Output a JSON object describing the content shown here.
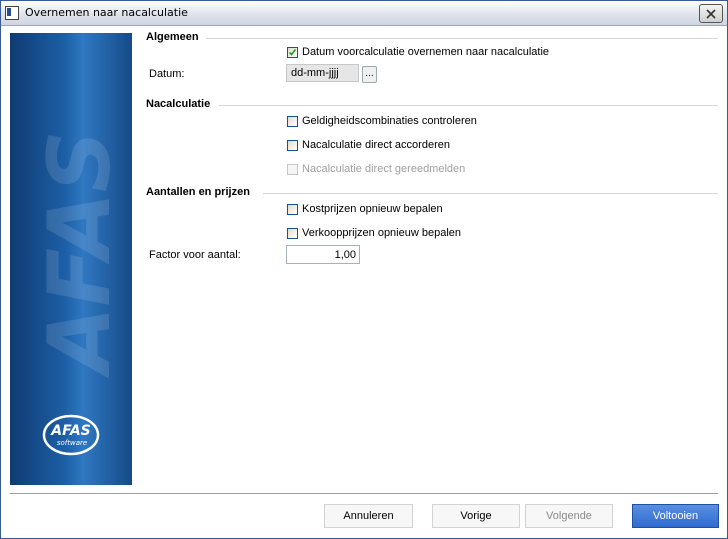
{
  "window": {
    "title": "Overnemen naar nacalculatie"
  },
  "sidebar": {
    "logo_text": "AFAS",
    "logo_subtext": "software"
  },
  "sections": {
    "algemeen": {
      "title": "Algemeen",
      "copy_date_checkbox": {
        "label": "Datum voorcalculatie overnemen naar nacalculatie",
        "checked": true
      },
      "date_label": "Datum:",
      "date_value": "dd-mm-jjjj",
      "date_button": "..."
    },
    "nacalculatie": {
      "title": "Nacalculatie",
      "check_validity": {
        "label": "Geldigheidscombinaties controleren",
        "checked": false
      },
      "approve_direct": {
        "label": "Nacalculatie direct accorderen",
        "checked": false
      },
      "report_ready": {
        "label": "Nacalculatie direct gereedmelden",
        "checked": false,
        "disabled": true
      }
    },
    "aantallen": {
      "title": "Aantallen en prijzen",
      "cost_prices": {
        "label": "Kostprijzen opnieuw bepalen",
        "checked": false
      },
      "sales_prices": {
        "label": "Verkoopprijzen opnieuw bepalen",
        "checked": false
      },
      "factor_label": "Factor voor aantal:",
      "factor_value": "1,00"
    }
  },
  "buttons": {
    "cancel": "Annuleren",
    "previous": "Vorige",
    "next": "Volgende",
    "finish": "Voltooien"
  },
  "colors": {
    "banner": "#1d5fa6",
    "primary_button": "#2f6bd0"
  }
}
